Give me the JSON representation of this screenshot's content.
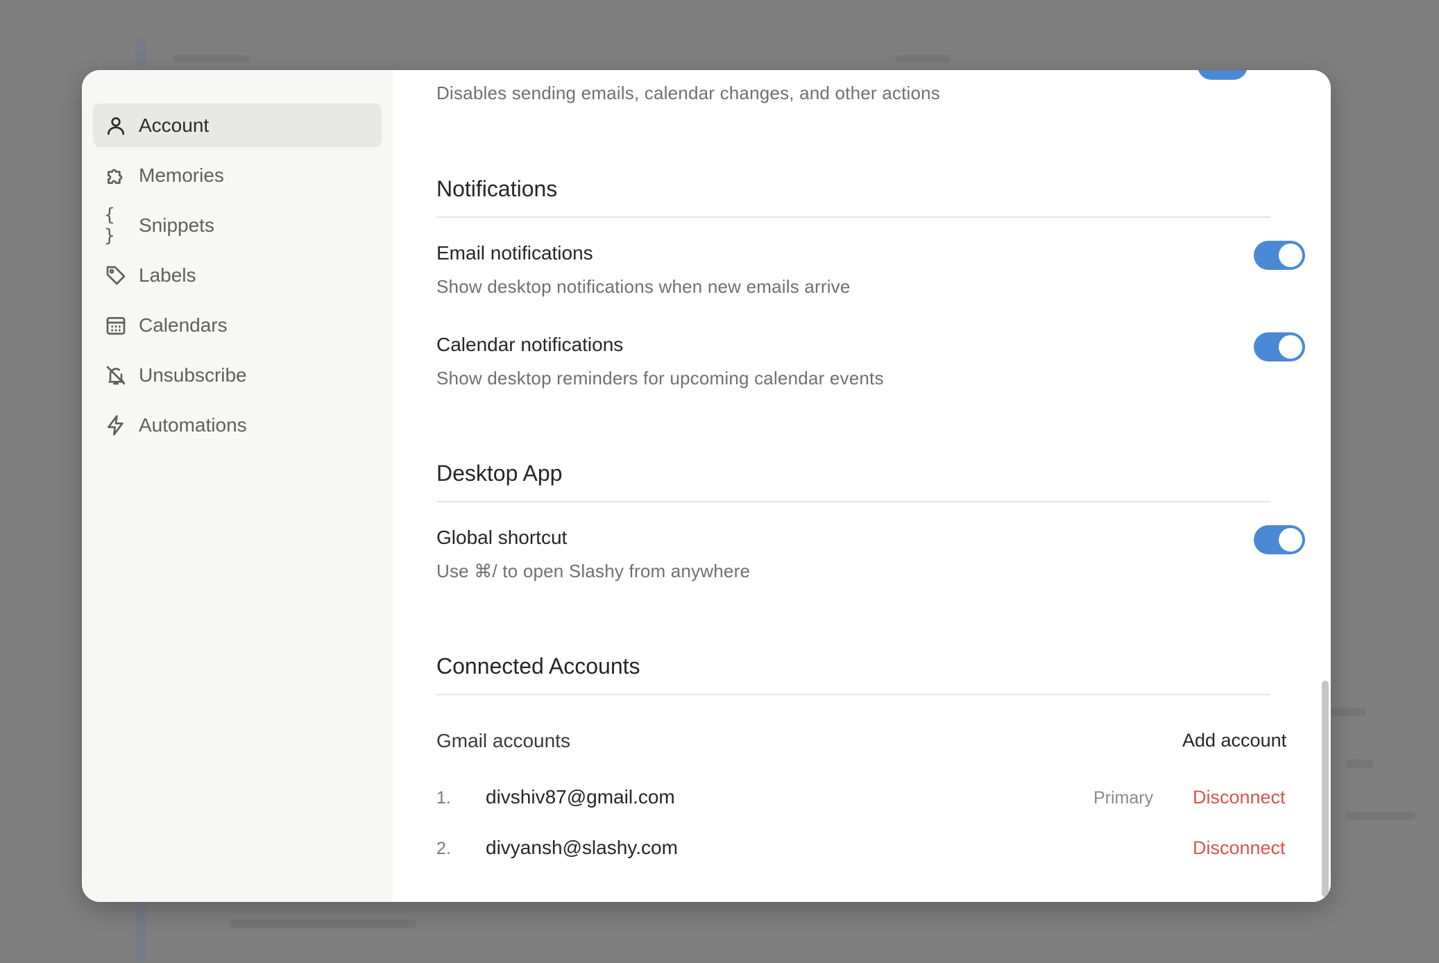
{
  "sidebar": {
    "items": [
      {
        "label": "Account",
        "icon": "user-icon",
        "active": true
      },
      {
        "label": "Memories",
        "icon": "puzzle-icon"
      },
      {
        "label": "Snippets",
        "icon": "braces-icon"
      },
      {
        "label": "Labels",
        "icon": "tag-icon"
      },
      {
        "label": "Calendars",
        "icon": "calendar-icon"
      },
      {
        "label": "Unsubscribe",
        "icon": "bell-off-icon"
      },
      {
        "label": "Automations",
        "icon": "bolt-icon"
      }
    ]
  },
  "top_partial": {
    "description": "Disables sending emails, calendar changes, and other actions"
  },
  "notifications": {
    "title": "Notifications",
    "email": {
      "title": "Email notifications",
      "description": "Show desktop notifications when new emails arrive",
      "enabled": true
    },
    "calendar": {
      "title": "Calendar notifications",
      "description": "Show desktop reminders for upcoming calendar events",
      "enabled": true
    }
  },
  "desktop_app": {
    "title": "Desktop App",
    "shortcut": {
      "title": "Global shortcut",
      "description": "Use ⌘/ to open Slashy from anywhere",
      "enabled": true
    }
  },
  "connected_accounts": {
    "title": "Connected Accounts",
    "gmail_label": "Gmail accounts",
    "add_label": "Add account",
    "accounts": [
      {
        "num": "1.",
        "email": "divshiv87@gmail.com",
        "tag": "Primary",
        "action": "Disconnect"
      },
      {
        "num": "2.",
        "email": "divyansh@slashy.com",
        "tag": "",
        "action": "Disconnect"
      }
    ]
  },
  "colors": {
    "accent": "#4a8ad4",
    "danger": "#d9544f",
    "sidebar_bg": "#f7f7f5",
    "active_bg": "#e8e8e6"
  }
}
